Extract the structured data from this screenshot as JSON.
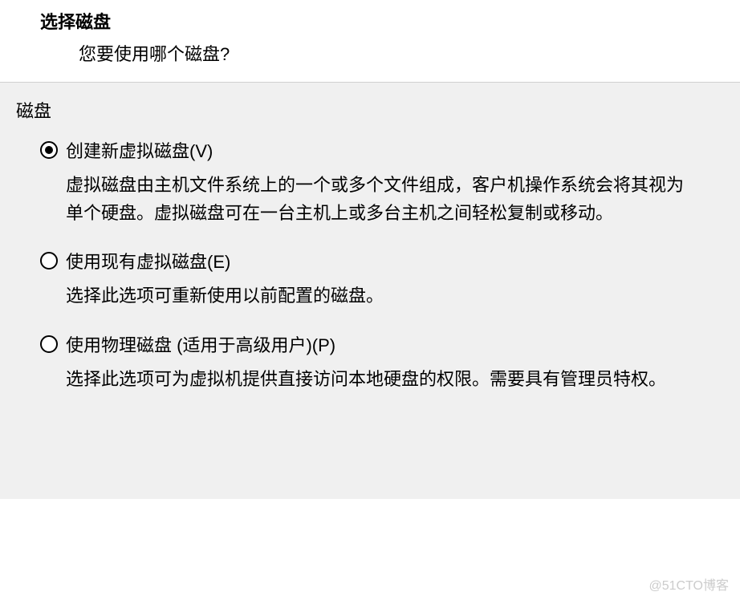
{
  "header": {
    "title": "选择磁盘",
    "subtitle": "您要使用哪个磁盘?"
  },
  "group": {
    "label": "磁盘"
  },
  "options": [
    {
      "label": "创建新虚拟磁盘(V)",
      "description": "虚拟磁盘由主机文件系统上的一个或多个文件组成，客户机操作系统会将其视为单个硬盘。虚拟磁盘可在一台主机上或多台主机之间轻松复制或移动。",
      "selected": true
    },
    {
      "label": "使用现有虚拟磁盘(E)",
      "description": "选择此选项可重新使用以前配置的磁盘。",
      "selected": false
    },
    {
      "label": "使用物理磁盘 (适用于高级用户)(P)",
      "description": "选择此选项可为虚拟机提供直接访问本地硬盘的权限。需要具有管理员特权。",
      "selected": false
    }
  ],
  "watermark": "@51CTO博客"
}
